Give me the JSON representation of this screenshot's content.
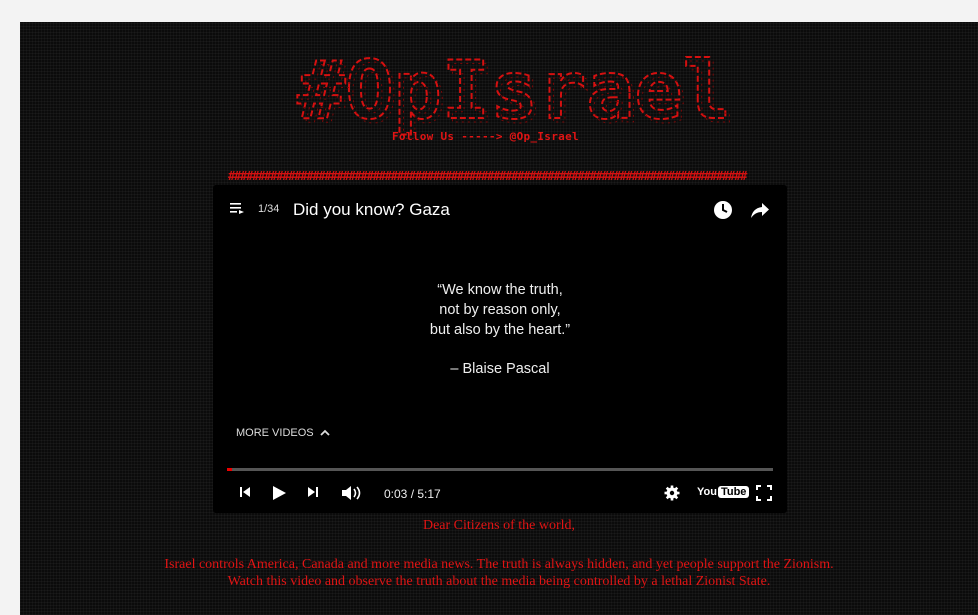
{
  "banner": {
    "text": "#OpIsrael",
    "follow_line": "Follow Us -----> @Op_Israel",
    "hash_line": "######################################################################################"
  },
  "player": {
    "playlist_count": "1/34",
    "title": "Did you know? Gaza",
    "quote_lines": [
      "“We know the truth,",
      "not by reason only,",
      "but also by the heart.”"
    ],
    "quote_author": "– Blaise Pascal",
    "more_videos_label": "MORE VIDEOS",
    "time": "0:03 / 5:17",
    "progress_fraction": 0.01,
    "youtube_logo": {
      "you": "You",
      "tube": "Tube"
    },
    "icons": [
      "playlist-icon",
      "clock-icon",
      "share-icon",
      "previous-icon",
      "play-icon",
      "next-icon",
      "volume-icon",
      "settings-icon",
      "fullscreen-icon",
      "chevron-up-icon"
    ]
  },
  "message": {
    "greeting": "Dear Citizens of the world,",
    "line1": "Israel controls America, Canada and more media news. The truth is always hidden, and yet people support the Zionism.",
    "line2": "Watch this video and observe the truth about the media being controlled by a lethal Zionist State."
  },
  "colors": {
    "accent_red": "#e01414",
    "progress_red": "#ee0000",
    "background": "#0b0b0b"
  }
}
